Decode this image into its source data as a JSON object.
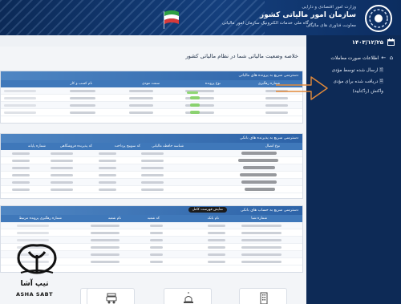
{
  "header": {
    "ministry": "وزارت امور اقتصادی و دارایی",
    "org": "سازمان امور مالیاتی کشور",
    "deputy": "معاونت فناوری های مالیاتی",
    "portal": "درگاه ملی خدمات الکترونیک سازمان امور مالیاتی"
  },
  "sidebar": {
    "date": "۱۴۰۳/۱۲/۲۵",
    "section": "اطلاعات صورت معاملات",
    "items": [
      {
        "label": "ارسال شده توسط مؤدی"
      },
      {
        "label": "دریافت شده برای مؤدی"
      },
      {
        "label": "واکنش (ردّ/تایید)"
      }
    ]
  },
  "main": {
    "title": "خلاصه وضعیت مالیاتی شما در نظام مالیاتی کشور",
    "panel1": {
      "header": "دسترسی سریع به پرونده های مالیاتی",
      "columns": [
        "شماره رهگیری",
        "نوع پرونده",
        "سمت مودی",
        "نام کسب و کار"
      ]
    },
    "panel2": {
      "header": "دسترسی سریع به پذیرنده های بانکی",
      "columns": [
        "نوع اتصال",
        "شناسه حافظه مالیاتی",
        "کد سوییچ پرداخت",
        "کد پذیرنده فروشگاهی",
        "شماره پایانه"
      ]
    },
    "panel3": {
      "header": "دسترسی سریع به حساب های بانکی",
      "show_all": "نمایش فهرست کامل",
      "columns": [
        "شماره شبا",
        "نام بانک",
        "کد شعبه",
        "نام شعبه",
        "شماره رهگیری پرونده مرتبط"
      ]
    }
  },
  "logo": {
    "name": "تیپ آشا",
    "latin": "ASHA SABT"
  },
  "colors": {
    "header": "#143f7d",
    "sidebar": "#0d2a56",
    "panel_header": "#2d63a8",
    "arrow": "#e38a3a",
    "status_green": "#7ed15d"
  }
}
